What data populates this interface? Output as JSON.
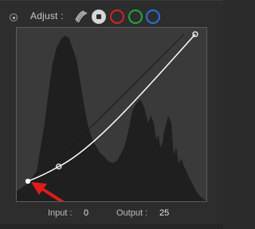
{
  "panel": {
    "adjust_label": "Adjust :"
  },
  "channels": [
    {
      "name": "all-channels",
      "icon": "stacked-curves-icon"
    },
    {
      "name": "luminance",
      "icon": "filled-circle-icon"
    },
    {
      "name": "red",
      "color": "#d42424"
    },
    {
      "name": "green",
      "color": "#21a83a"
    },
    {
      "name": "blue",
      "color": "#2d6fd6"
    }
  ],
  "curve": {
    "input_label": "Input :",
    "input_value": "0",
    "output_label": "Output :",
    "output_value": "25",
    "points": [
      {
        "input": 0,
        "output": 25
      },
      {
        "input": 47,
        "output": 48
      },
      {
        "input": 255,
        "output": 255
      }
    ],
    "curve_color": "#ffffff",
    "histogram_color": "#1f1f1f",
    "annotation_arrow_color": "#e11b1b"
  }
}
